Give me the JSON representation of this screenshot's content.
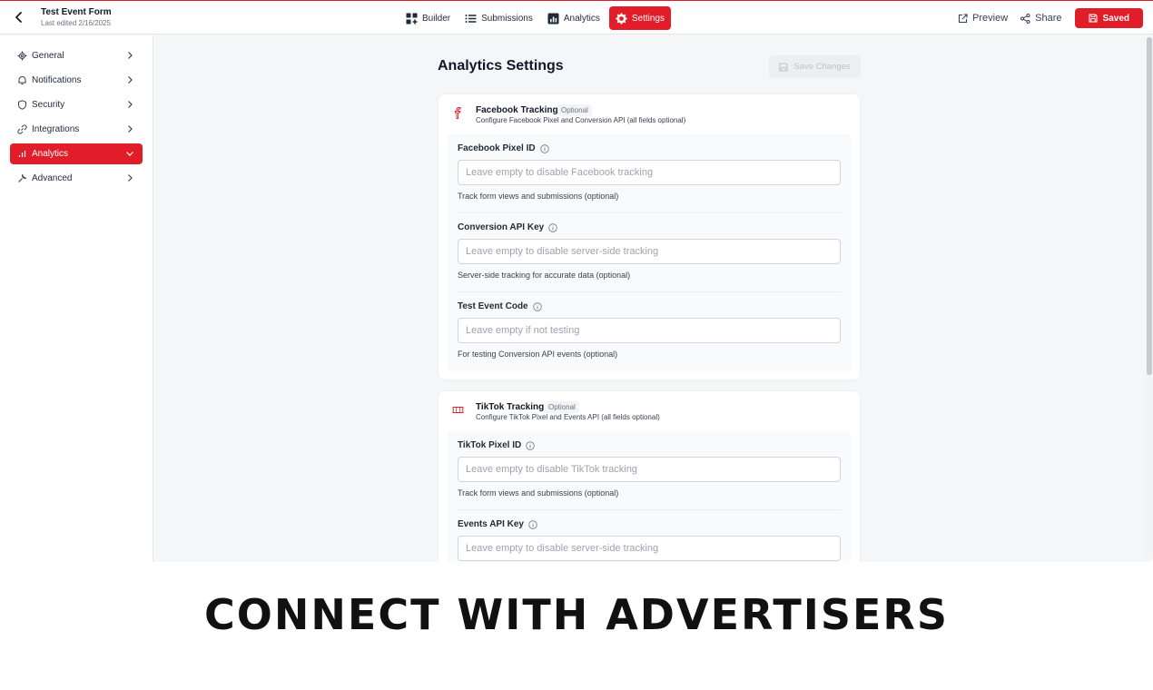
{
  "header": {
    "form_title": "Test Event Form",
    "last_edited": "Last edited 2/16/2025",
    "tabs": [
      {
        "label": "Builder",
        "icon": "grid-plus-icon"
      },
      {
        "label": "Submissions",
        "icon": "list-icon"
      },
      {
        "label": "Analytics",
        "icon": "bar-chart-icon"
      },
      {
        "label": "Settings",
        "icon": "gear-icon",
        "active": true
      }
    ],
    "preview_label": "Preview",
    "share_label": "Share",
    "saved_label": "Saved",
    "accent_color": "#e11d2a"
  },
  "sidebar": {
    "items": [
      {
        "label": "General",
        "icon": "gear-icon"
      },
      {
        "label": "Notifications",
        "icon": "bell-icon"
      },
      {
        "label": "Security",
        "icon": "shield-icon"
      },
      {
        "label": "Integrations",
        "icon": "link-icon"
      },
      {
        "label": "Analytics",
        "icon": "bar-chart-icon",
        "active": true
      },
      {
        "label": "Advanced",
        "icon": "wrench-icon"
      }
    ]
  },
  "main": {
    "title": "Analytics Settings",
    "save_changes_label": "Save Changes",
    "facebook": {
      "title": "Facebook Tracking",
      "badge": "Optional",
      "description": "Configure Facebook Pixel and Conversion API (all fields optional)",
      "fields": [
        {
          "label": "Facebook Pixel ID",
          "placeholder": "Leave empty to disable Facebook tracking",
          "help": "Track form views and submissions (optional)"
        },
        {
          "label": "Conversion API Key",
          "placeholder": "Leave empty to disable server-side tracking",
          "help": "Server-side tracking for accurate data (optional)"
        },
        {
          "label": "Test Event Code",
          "placeholder": "Leave empty if not testing",
          "help": "For testing Conversion API events (optional)"
        }
      ]
    },
    "tiktok": {
      "title": "TikTok Tracking",
      "badge": "Optional",
      "description": "Configure TikTok Pixel and Events API (all fields optional)",
      "fields": [
        {
          "label": "TikTok Pixel ID",
          "placeholder": "Leave empty to disable TikTok tracking",
          "help": "Track form views and submissions (optional)"
        },
        {
          "label": "Events API Key",
          "placeholder": "Leave empty to disable server-side tracking",
          "help": ""
        }
      ]
    }
  },
  "caption": "CONNECT WITH ADVERTISERS"
}
